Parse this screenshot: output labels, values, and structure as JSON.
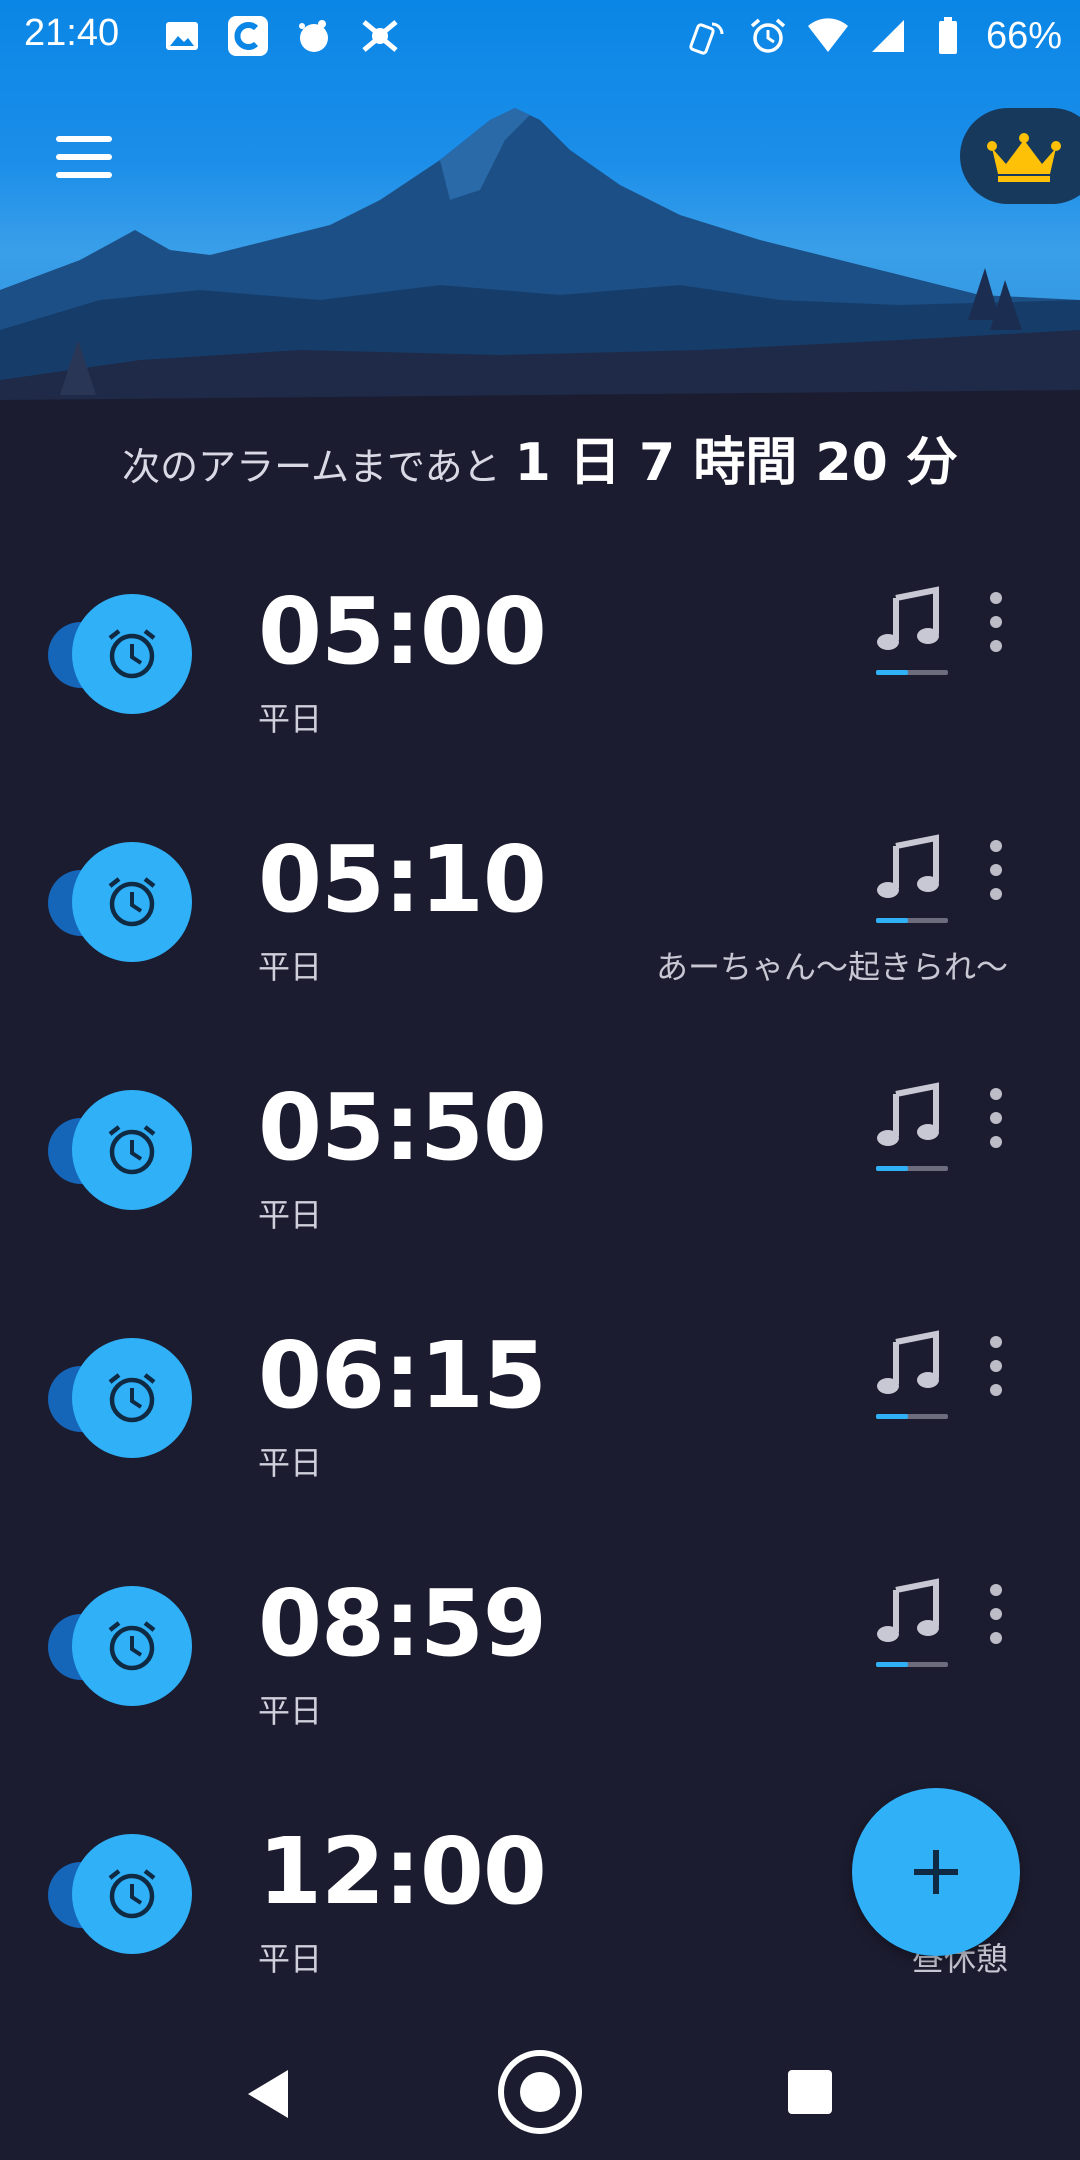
{
  "status_bar": {
    "time": "21:40",
    "left_icons": [
      "image-icon",
      "c-app-icon",
      "weather-icon",
      "bug-icon"
    ],
    "right_icons": [
      "nfc-icon",
      "alarm-icon",
      "wifi-icon",
      "signal-icon",
      "battery-icon"
    ],
    "battery": "66%"
  },
  "header": {
    "menu_icon": "hamburger-menu-icon",
    "premium_icon": "crown-icon"
  },
  "next_alarm": {
    "prefix": "次のアラームまであと",
    "value": "1 日 7 時間 20 分"
  },
  "alarms": [
    {
      "time": "05:00",
      "days": "平日",
      "label": "",
      "enabled": true
    },
    {
      "time": "05:10",
      "days": "平日",
      "label": "あーちゃん〜起きられ〜",
      "enabled": true
    },
    {
      "time": "05:50",
      "days": "平日",
      "label": "",
      "enabled": true
    },
    {
      "time": "06:15",
      "days": "平日",
      "label": "",
      "enabled": true
    },
    {
      "time": "08:59",
      "days": "平日",
      "label": "",
      "enabled": true
    },
    {
      "time": "12:00",
      "days": "平日",
      "label": "昼休憩",
      "enabled": true
    }
  ],
  "fab": {
    "icon": "plus-icon"
  },
  "navigation": {
    "back": "back-icon",
    "home": "home-icon",
    "recents": "recents-icon"
  },
  "colors": {
    "background": "#1c1c30",
    "accent": "#2fb0f7",
    "toggle_track": "#1565b8",
    "sky": "#1b8ee9",
    "mountain": "#0f3a66"
  }
}
